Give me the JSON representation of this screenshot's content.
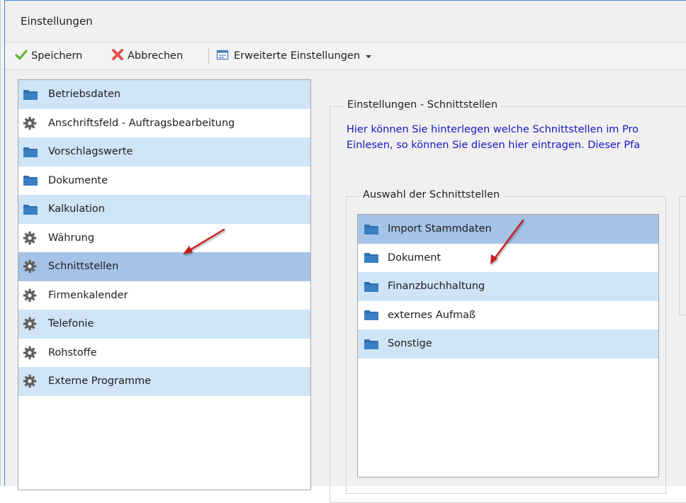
{
  "window": {
    "title": "Einstellungen"
  },
  "toolbar": {
    "save_label": "Speichern",
    "cancel_label": "Abbrechen",
    "advanced_label": "Erweiterte Einstellungen"
  },
  "nav": {
    "items": [
      {
        "label": "Betriebsdaten",
        "icon": "folder-icon"
      },
      {
        "label": "Anschriftsfeld - Auftragsbearbeitung",
        "icon": "gear-icon"
      },
      {
        "label": "Vorschlagswerte",
        "icon": "folder-icon"
      },
      {
        "label": "Dokumente",
        "icon": "folder-icon"
      },
      {
        "label": "Kalkulation",
        "icon": "folder-icon"
      },
      {
        "label": "Währung",
        "icon": "gear-icon"
      },
      {
        "label": "Schnittstellen",
        "icon": "gear-icon",
        "selected": true
      },
      {
        "label": "Firmenkalender",
        "icon": "gear-icon"
      },
      {
        "label": "Telefonie",
        "icon": "gear-icon"
      },
      {
        "label": "Rohstoffe",
        "icon": "gear-icon"
      },
      {
        "label": "Externe Programme",
        "icon": "gear-icon"
      }
    ]
  },
  "settings": {
    "group_title": "Einstellungen - Schnittstellen",
    "info_line1": "Hier können Sie hinterlegen welche Schnittstellen im Pro",
    "info_line2": "Einlesen, so können Sie diesen hier eintragen. Dieser Pfa",
    "selection": {
      "group_title": "Auswahl der Schnittstellen",
      "items": [
        {
          "label": "Import Stammdaten",
          "icon": "folder-icon",
          "selected": true
        },
        {
          "label": "Dokument",
          "icon": "folder-icon"
        },
        {
          "label": "Finanzbuchhaltung",
          "icon": "folder-icon"
        },
        {
          "label": "externes Aufmaß",
          "icon": "folder-icon"
        },
        {
          "label": "Sonstige",
          "icon": "folder-icon"
        }
      ]
    }
  },
  "colors": {
    "accent_border": "#3c8ed9",
    "row_alt": "#cfe4f6",
    "row_selected": "#a5c3e7",
    "info_text": "#1a17c2",
    "annotation_arrow": "#c81e1e"
  }
}
